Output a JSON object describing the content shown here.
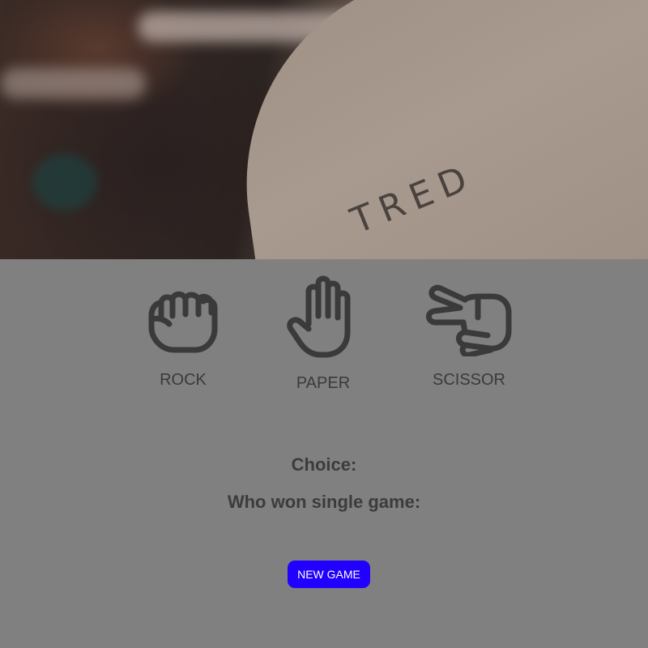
{
  "choices": [
    {
      "label": "ROCK",
      "icon": "fist-icon"
    },
    {
      "label": "PAPER",
      "icon": "open-hand-icon"
    },
    {
      "label": "SCISSOR",
      "icon": "scissors-hand-icon"
    }
  ],
  "result": {
    "choice_label": "Choice:",
    "winner_label": "Who won single game:"
  },
  "new_game_button": "NEW GAME",
  "hero_text": "TRED",
  "colors": {
    "background": "#808080",
    "icon": "#3a3a3a",
    "button": "#2200ff",
    "button_text": "#ffffff"
  }
}
